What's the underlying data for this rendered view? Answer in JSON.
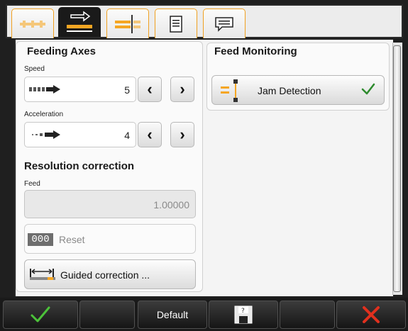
{
  "tabs": [
    {
      "icon": "feed-rollers-icon"
    },
    {
      "icon": "feed-direction-icon",
      "active": true
    },
    {
      "icon": "feed-cut-icon"
    },
    {
      "icon": "document-icon"
    },
    {
      "icon": "message-icon"
    }
  ],
  "feeding_axes": {
    "title": "Feeding Axes",
    "speed": {
      "label": "Speed",
      "value": "5"
    },
    "acceleration": {
      "label": "Acceleration",
      "value": "4"
    }
  },
  "resolution_correction": {
    "title": "Resolution correction",
    "feed_label": "Feed",
    "feed_value": "1.00000",
    "reset_badge": "000",
    "reset_label": "Reset",
    "guided_label": "Guided correction ..."
  },
  "feed_monitoring": {
    "title": "Feed Monitoring",
    "jam_detection_label": "Jam Detection",
    "jam_detection_enabled": true
  },
  "bottom": {
    "default_label": "Default",
    "ok_icon": "checkmark-icon",
    "save_icon": "save-icon",
    "cancel_icon": "close-icon"
  },
  "colors": {
    "accent": "#f5a623",
    "ok_green": "#3aa832",
    "cancel_red": "#e0301e"
  }
}
